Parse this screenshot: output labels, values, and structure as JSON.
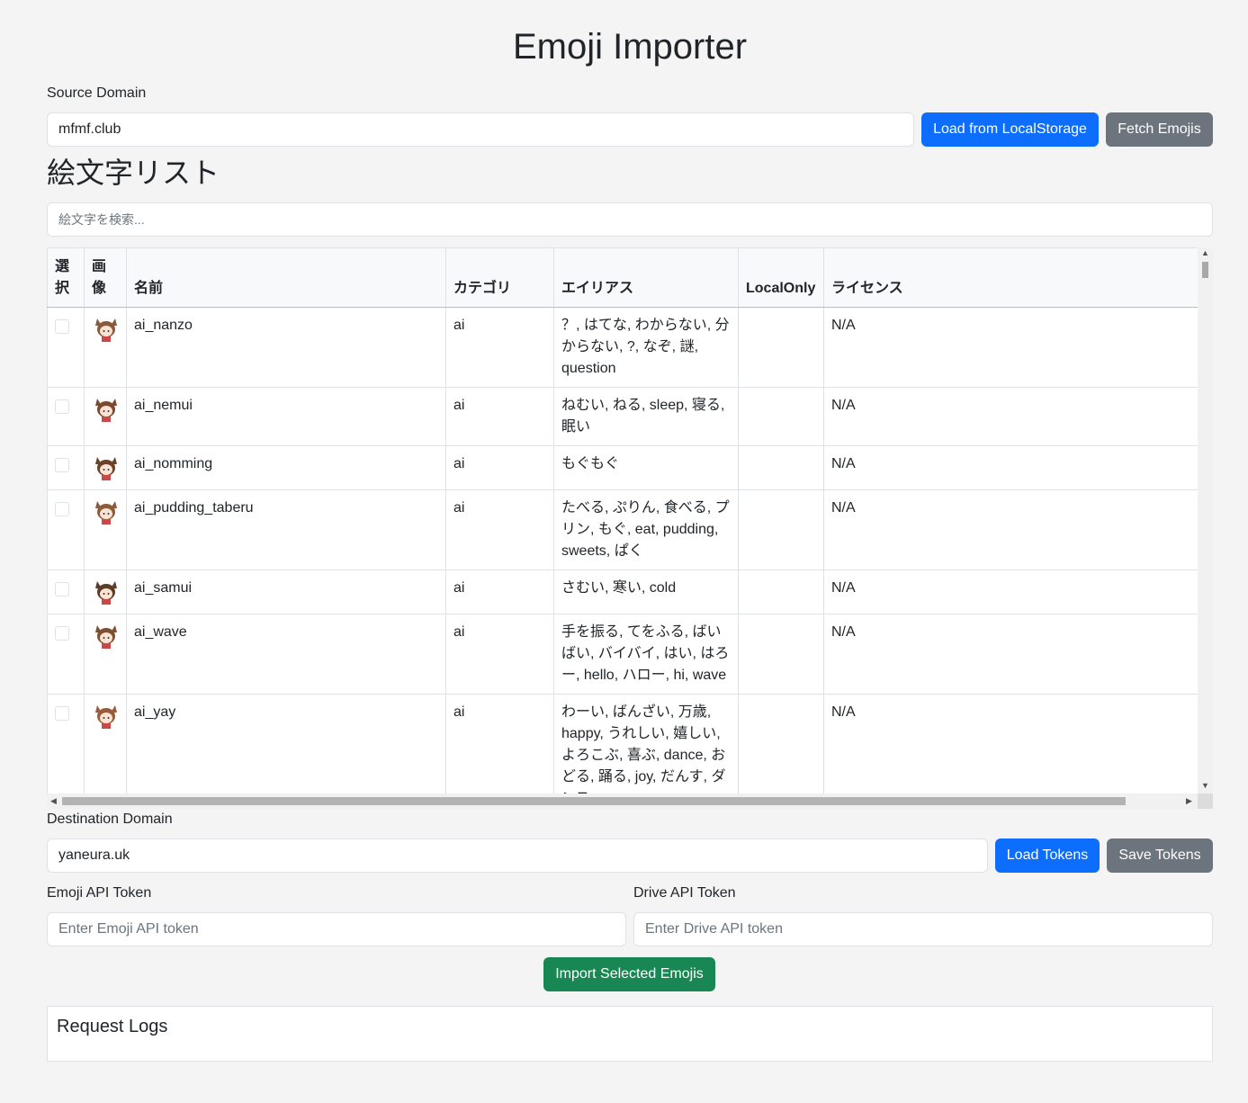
{
  "app": {
    "title": "Emoji Importer"
  },
  "source": {
    "label": "Source Domain",
    "value": "mfmf.club",
    "load_label": "Load from LocalStorage",
    "fetch_label": "Fetch Emojis"
  },
  "list": {
    "title": "絵文字リスト",
    "search_placeholder": "絵文字を検索..."
  },
  "table": {
    "headers": {
      "select": "選択",
      "image": "画像",
      "name": "名前",
      "category": "カテゴリ",
      "aliases": "エイリアス",
      "local_only": "LocalOnly",
      "license": "ライセンス"
    },
    "rows": [
      {
        "name": "ai_nanzo",
        "category": "ai",
        "aliases": "？, はてな, わからない, 分からない, ?, なぞ, 謎, question",
        "local_only": "",
        "license": "N/A",
        "image": "ai-nanzo-emoji"
      },
      {
        "name": "ai_nemui",
        "category": "ai",
        "aliases": "ねむい, ねる, sleep, 寝る, 眠い",
        "local_only": "",
        "license": "N/A",
        "image": "ai-nemui-emoji"
      },
      {
        "name": "ai_nomming",
        "category": "ai",
        "aliases": "もぐもぐ",
        "local_only": "",
        "license": "N/A",
        "image": "ai-nomming-emoji"
      },
      {
        "name": "ai_pudding_taberu",
        "category": "ai",
        "aliases": "たべる, ぷりん, 食べる, プリン, もぐ, eat, pudding, sweets, ぱく",
        "local_only": "",
        "license": "N/A",
        "image": "ai-pudding-emoji"
      },
      {
        "name": "ai_samui",
        "category": "ai",
        "aliases": "さむい, 寒い, cold",
        "local_only": "",
        "license": "N/A",
        "image": "ai-samui-emoji"
      },
      {
        "name": "ai_wave",
        "category": "ai",
        "aliases": "手を振る, てをふる, ばいばい, バイバイ, はい, はろー, hello, ハロー, hi, wave",
        "local_only": "",
        "license": "N/A",
        "image": "ai-wave-emoji"
      },
      {
        "name": "ai_yay",
        "category": "ai",
        "aliases": "わーい, ばんざい, 万歳, happy, うれしい, 嬉しい, よろこぶ, 喜ぶ, dance, おどる, 踊る, joy, だんす, ダンス",
        "local_only": "",
        "license": "N/A",
        "image": "ai-yay-emoji"
      }
    ]
  },
  "destination": {
    "label": "Destination Domain",
    "value": "yaneura.uk",
    "load_tokens_label": "Load Tokens",
    "save_tokens_label": "Save Tokens"
  },
  "tokens": {
    "emoji_label": "Emoji API Token",
    "emoji_placeholder": "Enter Emoji API token",
    "drive_label": "Drive API Token",
    "drive_placeholder": "Enter Drive API token"
  },
  "actions": {
    "import_label": "Import Selected Emojis"
  },
  "logs": {
    "title": "Request Logs"
  }
}
